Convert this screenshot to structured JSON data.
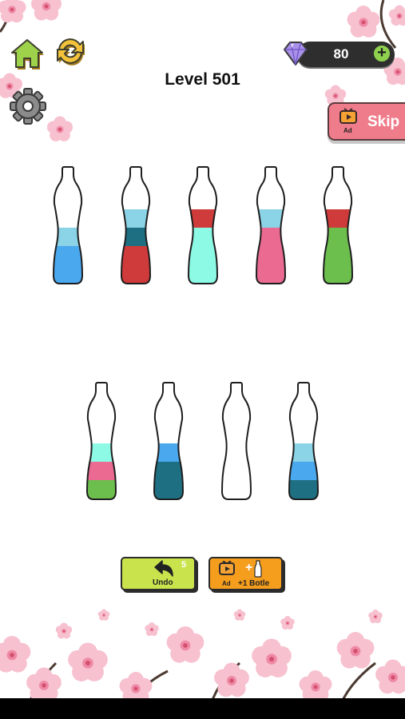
{
  "header": {
    "level_title": "Level 501",
    "gem_count": "80",
    "icons": {
      "home": "home-icon",
      "restart": "restart-icon",
      "settings": "gear-icon",
      "gem": "diamond-icon",
      "add_gems": "plus-icon"
    }
  },
  "skip": {
    "label": "Skip",
    "ad_badge": "Ad"
  },
  "colors": {
    "light_blue": "#8bd3e6",
    "blue": "#4aa8ef",
    "dark_teal": "#1e6f82",
    "red": "#cf3a3a",
    "aqua": "#8dfae6",
    "pink": "#ea6a92",
    "green": "#6cbf4d",
    "skip_pink": "#ef7c8a",
    "undo_green": "#c9e34d",
    "bottle_orange": "#f59d1c"
  },
  "bottles": [
    {
      "layers_bottom_to_top": [
        "blue",
        "blue",
        "light_blue"
      ]
    },
    {
      "layers_bottom_to_top": [
        "red",
        "red",
        "dark_teal",
        "light_blue"
      ]
    },
    {
      "layers_bottom_to_top": [
        "aqua",
        "aqua",
        "aqua",
        "red"
      ]
    },
    {
      "layers_bottom_to_top": [
        "pink",
        "pink",
        "pink",
        "light_blue"
      ]
    },
    {
      "layers_bottom_to_top": [
        "green",
        "green",
        "green",
        "red"
      ]
    },
    {
      "layers_bottom_to_top": [
        "green",
        "pink",
        "aqua"
      ]
    },
    {
      "layers_bottom_to_top": [
        "dark_teal",
        "dark_teal",
        "blue"
      ]
    },
    {
      "layers_bottom_to_top": []
    },
    {
      "layers_bottom_to_top": [
        "dark_teal",
        "blue",
        "light_blue"
      ]
    }
  ],
  "actions": {
    "undo_label": "Undo",
    "undo_count": "5",
    "add_bottle_label": "+1 Botle",
    "add_bottle_ad_badge": "Ad"
  }
}
